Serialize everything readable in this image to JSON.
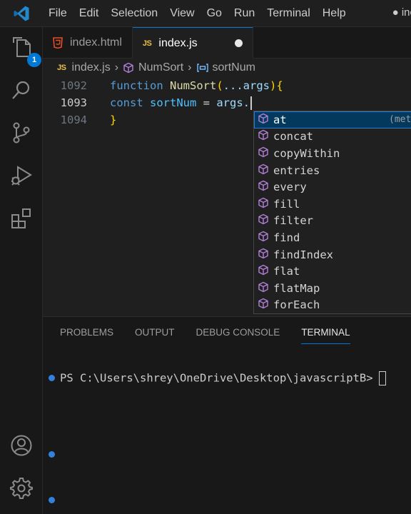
{
  "menu": [
    "File",
    "Edit",
    "Selection",
    "View",
    "Go",
    "Run",
    "Terminal",
    "Help"
  ],
  "title_right": "● inc",
  "activity": {
    "explorer_badge": "1"
  },
  "tabs": [
    {
      "label": "index.html",
      "icon": "html5-icon",
      "active": false
    },
    {
      "label": "index.js",
      "icon": "js-icon",
      "active": true,
      "modified": true
    }
  ],
  "js_icon_text": "JS",
  "breadcrumb": {
    "file": "index.js",
    "fn": "NumSort",
    "symbol": "sortNum"
  },
  "editor": {
    "lines": [
      {
        "num": "1092",
        "t1": "function",
        "t2": "NumSort",
        "t3": "(",
        "t4": "...args",
        "t5": ")",
        "t6": "{"
      },
      {
        "num": "1093",
        "t1": "const",
        "t2": "sortNum",
        "t3": " = ",
        "t4": "args.",
        "t5": "",
        "t6": ""
      },
      {
        "num": "1094",
        "t1": "}",
        "t2": "",
        "t3": "",
        "t4": "",
        "t5": "",
        "t6": ""
      }
    ]
  },
  "suggest": {
    "detail": "(metho",
    "items": [
      "at",
      "concat",
      "copyWithin",
      "entries",
      "every",
      "fill",
      "filter",
      "find",
      "findIndex",
      "flat",
      "flatMap",
      "forEach"
    ]
  },
  "panel": {
    "tabs": [
      "PROBLEMS",
      "OUTPUT",
      "DEBUG CONSOLE",
      "TERMINAL"
    ],
    "active_tab": "TERMINAL",
    "prompt": "PS C:\\Users\\shrey\\OneDrive\\Desktop\\javascriptB>"
  },
  "colors": {
    "accent": "#0078d4",
    "keyword": "#569cd6",
    "function": "#dcdcaa",
    "variable": "#4fc1ff"
  }
}
